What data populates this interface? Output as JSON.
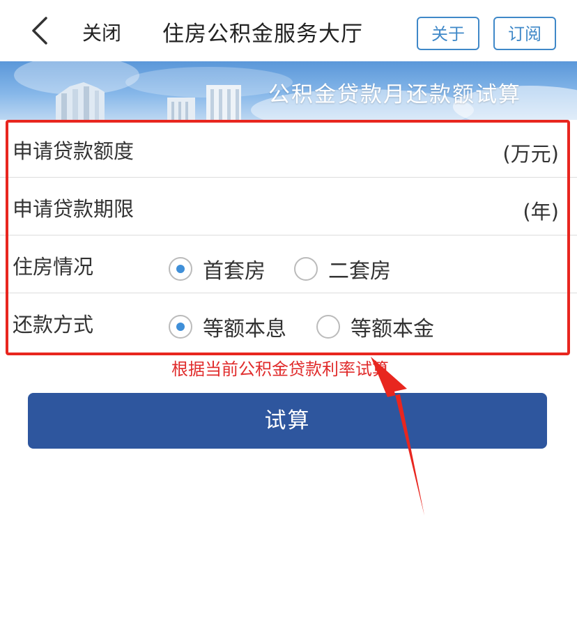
{
  "nav": {
    "close_label": "关闭",
    "title": "住房公积金服务大厅",
    "about_label": "关于",
    "subscribe_label": "订阅"
  },
  "banner": {
    "title": "公积金贷款月还款额试算"
  },
  "form": {
    "loan_amount": {
      "label": "申请贷款额度",
      "unit": "(万元)",
      "value": ""
    },
    "loan_term": {
      "label": "申请贷款期限",
      "unit": "(年)",
      "value": ""
    },
    "housing": {
      "label": "住房情况",
      "options": [
        "首套房",
        "二套房"
      ],
      "selected": "首套房"
    },
    "repayment": {
      "label": "还款方式",
      "options": [
        "等额本息",
        "等额本金"
      ],
      "selected": "等额本息"
    }
  },
  "note": "根据当前公积金贷款利率试算",
  "submit_label": "试算",
  "colors": {
    "accent": "#3f88c8",
    "button": "#2e569e",
    "annotation": "#e8261f"
  }
}
